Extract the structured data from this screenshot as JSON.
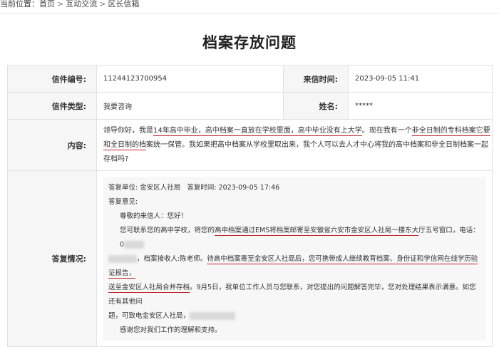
{
  "breadcrumb": {
    "prefix": "当前位置：",
    "items": [
      "首页",
      "互动交流",
      "区长信箱"
    ],
    "separator": ">"
  },
  "page_title": "档案存放问题",
  "letter": {
    "id_label": "信件编号:",
    "id_value": "11244123700954",
    "time_label": "来信时间:",
    "time_value": "2023-09-05 11:41",
    "type_label": "信件类型:",
    "type_value": "我要咨询",
    "name_label": "姓名:",
    "name_value": "*****",
    "content_label": "内容:",
    "content": {
      "p1": "领导你好，我是",
      "u1": "14年高中毕业，高中档案一直放在学校里面，高中毕业没有上大学",
      "p2": "。现在我有一个",
      "u2": "非全日制的专科档案它要和全日制的档",
      "p3": "案统一保管。我如果把高中档案从学校里取出来，我个人可以去人才中心将我的高中档案和非全日制档案一起存档吗?"
    }
  },
  "reply": {
    "label": "答复情况:",
    "unit_label": "答复单位:",
    "unit": "金安区人社局",
    "time_label": "答复时间:",
    "time": "2023-09-05 17:46",
    "opinion_label": "答复意见:",
    "greeting": "尊敬的来信人：您好！",
    "b1": "您可联系您的高中学校，将您的",
    "b1u": "高中档案通过EMS将档案邮寄至安徽省六安市金安区人社局一楼东大",
    "b2": "厅五号窗口，电话：0",
    "b3": "，档案接收人:陈老师。",
    "b3u": "待高中档案寄至金安区人社局后，您可携带成人继续教育档案、身份证和学信网在线学历验证报告，",
    "b4u": "送至金安区人社局合并存档",
    "b4": "。9月5日，我单位工作人员与您联系，对您提出的问题解答完毕，您对处理结果表示满意。如您还有其他问",
    "b5": "题，可致电金安区人社局，",
    "closing": "感谢您对我们工作的理解和支持。"
  },
  "colors": {
    "underline": "#c0272d",
    "label_bg": "#f6f6f6",
    "border": "#e2e2e2"
  }
}
